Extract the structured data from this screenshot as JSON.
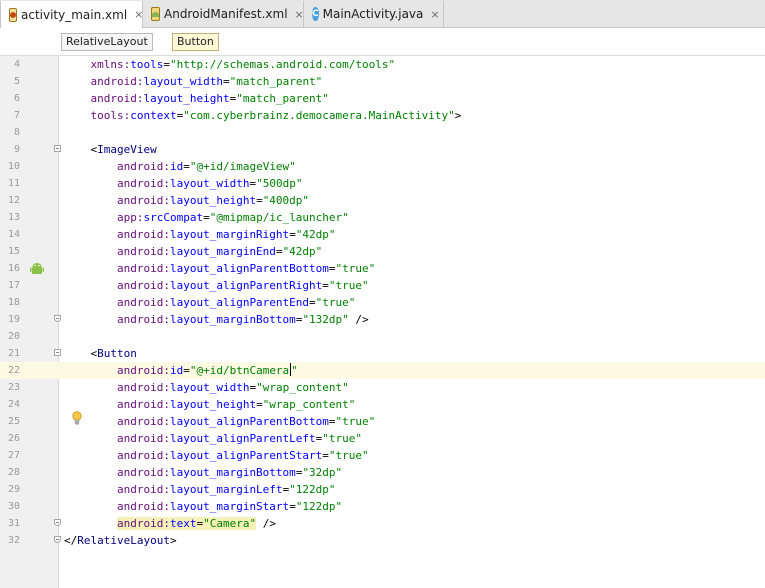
{
  "tabs": [
    {
      "label": "activity_main.xml",
      "icon": "xml-layout-icon",
      "active": true
    },
    {
      "label": "AndroidManifest.xml",
      "icon": "manifest-icon",
      "active": false
    },
    {
      "label": "MainActivity.java",
      "icon": "java-class-icon",
      "active": false
    }
  ],
  "tab_close_glyph": "×",
  "breadcrumbs": [
    "RelativeLayout",
    "Button"
  ],
  "java_icon_letter": "C",
  "code_lines": [
    {
      "n": "4",
      "tokens": [
        [
          "ns",
          "    xmlns:"
        ],
        [
          "at",
          "tools"
        ],
        [
          "pl",
          "="
        ],
        [
          "val",
          "\"http://schemas.android.com/tools\""
        ]
      ]
    },
    {
      "n": "5",
      "tokens": [
        [
          "ns",
          "    android:"
        ],
        [
          "at",
          "layout_width"
        ],
        [
          "pl",
          "="
        ],
        [
          "val",
          "\"match_parent\""
        ]
      ]
    },
    {
      "n": "6",
      "tokens": [
        [
          "ns",
          "    android:"
        ],
        [
          "at",
          "layout_height"
        ],
        [
          "pl",
          "="
        ],
        [
          "val",
          "\"match_parent\""
        ]
      ]
    },
    {
      "n": "7",
      "tokens": [
        [
          "ns",
          "    tools:"
        ],
        [
          "at",
          "context"
        ],
        [
          "pl",
          "="
        ],
        [
          "val",
          "\"com.cyberbrainz.democamera.MainActivity\""
        ],
        [
          "pl",
          ">"
        ]
      ]
    },
    {
      "n": "8",
      "tokens": []
    },
    {
      "n": "9",
      "tokens": [
        [
          "pl",
          "    <"
        ],
        [
          "tag",
          "ImageView"
        ]
      ]
    },
    {
      "n": "10",
      "tokens": [
        [
          "ns",
          "        android:"
        ],
        [
          "at",
          "id"
        ],
        [
          "pl",
          "="
        ],
        [
          "val",
          "\"@+id/imageView\""
        ]
      ]
    },
    {
      "n": "11",
      "tokens": [
        [
          "ns",
          "        android:"
        ],
        [
          "at",
          "layout_width"
        ],
        [
          "pl",
          "="
        ],
        [
          "val",
          "\"500dp\""
        ]
      ]
    },
    {
      "n": "12",
      "tokens": [
        [
          "ns",
          "        android:"
        ],
        [
          "at",
          "layout_height"
        ],
        [
          "pl",
          "="
        ],
        [
          "val",
          "\"400dp\""
        ]
      ]
    },
    {
      "n": "13",
      "tokens": [
        [
          "ns",
          "        app:"
        ],
        [
          "at",
          "srcCompat"
        ],
        [
          "pl",
          "="
        ],
        [
          "val",
          "\"@mipmap/ic_launcher\""
        ]
      ]
    },
    {
      "n": "14",
      "tokens": [
        [
          "ns",
          "        android:"
        ],
        [
          "at",
          "layout_marginRight"
        ],
        [
          "pl",
          "="
        ],
        [
          "val",
          "\"42dp\""
        ]
      ]
    },
    {
      "n": "15",
      "tokens": [
        [
          "ns",
          "        android:"
        ],
        [
          "at",
          "layout_marginEnd"
        ],
        [
          "pl",
          "="
        ],
        [
          "val",
          "\"42dp\""
        ]
      ]
    },
    {
      "n": "16",
      "tokens": [
        [
          "ns",
          "        android:"
        ],
        [
          "at",
          "layout_alignParentBottom"
        ],
        [
          "pl",
          "="
        ],
        [
          "val",
          "\"true\""
        ]
      ]
    },
    {
      "n": "17",
      "tokens": [
        [
          "ns",
          "        android:"
        ],
        [
          "at",
          "layout_alignParentRight"
        ],
        [
          "pl",
          "="
        ],
        [
          "val",
          "\"true\""
        ]
      ]
    },
    {
      "n": "18",
      "tokens": [
        [
          "ns",
          "        android:"
        ],
        [
          "at",
          "layout_alignParentEnd"
        ],
        [
          "pl",
          "="
        ],
        [
          "val",
          "\"true\""
        ]
      ]
    },
    {
      "n": "19",
      "tokens": [
        [
          "ns",
          "        android:"
        ],
        [
          "at",
          "layout_marginBottom"
        ],
        [
          "pl",
          "="
        ],
        [
          "val",
          "\"132dp\""
        ],
        [
          "pl",
          " />"
        ]
      ]
    },
    {
      "n": "20",
      "tokens": []
    },
    {
      "n": "21",
      "tokens": [
        [
          "pl",
          "    <"
        ],
        [
          "tag",
          "Button"
        ]
      ]
    },
    {
      "n": "22",
      "tokens": [
        [
          "ns",
          "        android:"
        ],
        [
          "at",
          "id"
        ],
        [
          "pl",
          "="
        ],
        [
          "val",
          "\"@+id/btnCamera"
        ],
        [
          "caret",
          ""
        ],
        [
          "val",
          "\""
        ]
      ]
    },
    {
      "n": "23",
      "tokens": [
        [
          "ns",
          "        android:"
        ],
        [
          "at",
          "layout_width"
        ],
        [
          "pl",
          "="
        ],
        [
          "val",
          "\"wrap_content\""
        ]
      ]
    },
    {
      "n": "24",
      "tokens": [
        [
          "ns",
          "        android:"
        ],
        [
          "at",
          "layout_height"
        ],
        [
          "pl",
          "="
        ],
        [
          "val",
          "\"wrap_content\""
        ]
      ]
    },
    {
      "n": "25",
      "tokens": [
        [
          "ns",
          "        android:"
        ],
        [
          "at",
          "layout_alignParentBottom"
        ],
        [
          "pl",
          "="
        ],
        [
          "val",
          "\"true\""
        ]
      ]
    },
    {
      "n": "26",
      "tokens": [
        [
          "ns",
          "        android:"
        ],
        [
          "at",
          "layout_alignParentLeft"
        ],
        [
          "pl",
          "="
        ],
        [
          "val",
          "\"true\""
        ]
      ]
    },
    {
      "n": "27",
      "tokens": [
        [
          "ns",
          "        android:"
        ],
        [
          "at",
          "layout_alignParentStart"
        ],
        [
          "pl",
          "="
        ],
        [
          "val",
          "\"true\""
        ]
      ]
    },
    {
      "n": "28",
      "tokens": [
        [
          "ns",
          "        android:"
        ],
        [
          "at",
          "layout_marginBottom"
        ],
        [
          "pl",
          "="
        ],
        [
          "val",
          "\"32dp\""
        ]
      ]
    },
    {
      "n": "29",
      "tokens": [
        [
          "ns",
          "        android:"
        ],
        [
          "at",
          "layout_marginLeft"
        ],
        [
          "pl",
          "="
        ],
        [
          "val",
          "\"122dp\""
        ]
      ]
    },
    {
      "n": "30",
      "tokens": [
        [
          "ns",
          "        android:"
        ],
        [
          "at",
          "layout_marginStart"
        ],
        [
          "pl",
          "="
        ],
        [
          "val",
          "\"122dp\""
        ]
      ]
    },
    {
      "n": "31",
      "tokens": [
        [
          "pl",
          "        "
        ],
        [
          "hlns",
          "android:"
        ],
        [
          "hlat",
          "text"
        ],
        [
          "hlpl",
          "="
        ],
        [
          "hlval",
          "\"Camera\""
        ],
        [
          "pl",
          " />"
        ]
      ]
    },
    {
      "n": "32",
      "tokens": [
        [
          "pl",
          "</"
        ],
        [
          "tag",
          "RelativeLayout"
        ],
        [
          "pl",
          ">"
        ]
      ]
    }
  ],
  "current_line": "22",
  "colors": {
    "namespace": "#660e7a",
    "attribute": "#0000ff",
    "value": "#008000",
    "tag": "#000080",
    "current_line_bg": "#fcfae2",
    "highlight_bg": "#f5f1b8"
  }
}
